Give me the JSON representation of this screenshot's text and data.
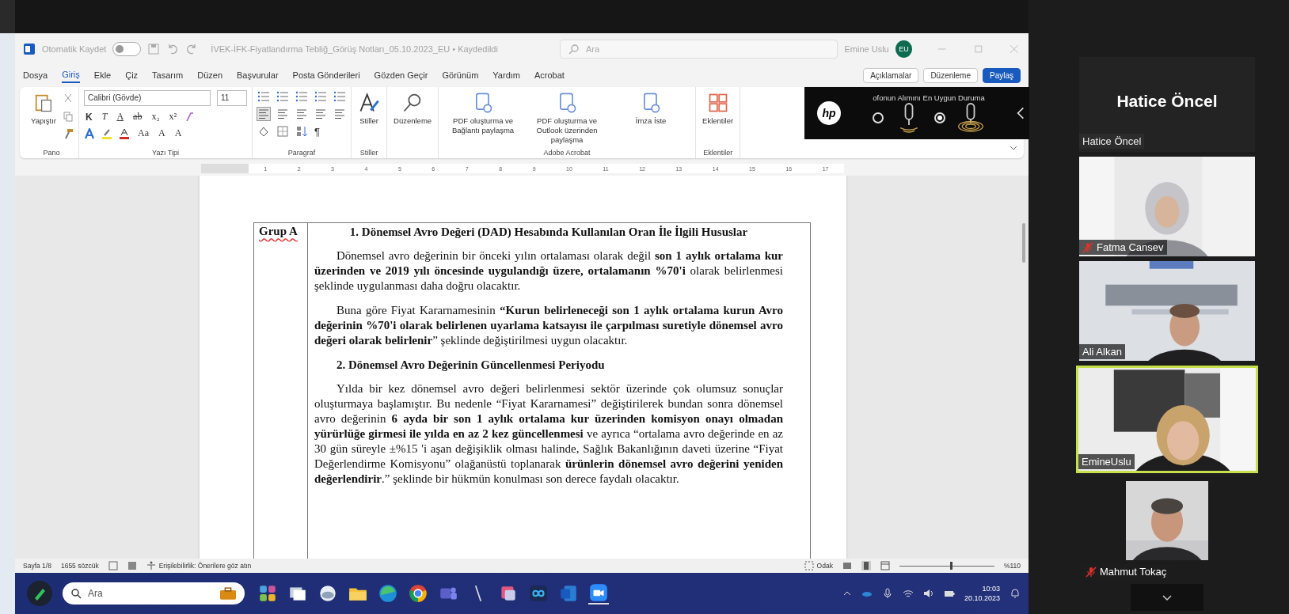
{
  "window": {
    "title": "İVEK-İFK-Fiyatlandırma Tebliğ_Görüş Notları_05.10.2023_EU • Kaydedildi",
    "autosave": {
      "label": "Otomatik Kaydet",
      "on": false
    },
    "search": {
      "placeholder": "Ara"
    },
    "user": {
      "name": "Emine Uslu",
      "initials": "EU"
    }
  },
  "menu_tabs": [
    {
      "label": "Dosya",
      "selected": false
    },
    {
      "label": "Giriş",
      "selected": true
    },
    {
      "label": "Ekle",
      "selected": false
    },
    {
      "label": "Çiz",
      "selected": false
    },
    {
      "label": "Tasarım",
      "selected": false
    },
    {
      "label": "Düzen",
      "selected": false
    },
    {
      "label": "Başvurular",
      "selected": false
    },
    {
      "label": "Posta Gönderileri",
      "selected": false
    },
    {
      "label": "Gözden Geçir",
      "selected": false
    },
    {
      "label": "Görünüm",
      "selected": false
    },
    {
      "label": "Yardım",
      "selected": false
    },
    {
      "label": "Acrobat",
      "selected": false
    }
  ],
  "actions": [
    "Açıklamalar",
    "Düzenleme",
    "Paylaş"
  ],
  "ribbon": {
    "clipboard": {
      "paste": "Yapıştır",
      "group": "Pano"
    },
    "font": {
      "name": "Calibri (Gövde)",
      "size": "11",
      "format_buttons": [
        "K",
        "T",
        "A",
        "ab",
        "x₂",
        "x²"
      ],
      "size_buttons": [
        "Aa",
        "A",
        "A"
      ],
      "group": "Yazı Tipi"
    },
    "paragraph": {
      "mark": "¶",
      "group": "Paragraf"
    },
    "styles": {
      "label": "Stiller",
      "group": "Stiller"
    },
    "editing": {
      "label": "Düzenleme"
    },
    "acrobat": {
      "buttons": [
        "PDF oluşturma ve Bağlantı paylaşma",
        "PDF oluşturma ve Outlook üzerinden paylaşma",
        "İmza İste"
      ],
      "group": "Adobe Acrobat"
    },
    "addins": {
      "label": "Eklentiler",
      "group": "Eklentiler"
    }
  },
  "ruler": [
    "1",
    "2",
    "3",
    "4",
    "5",
    "6",
    "7",
    "8",
    "9",
    "10",
    "11",
    "12",
    "13",
    "14",
    "15",
    "16",
    "17"
  ],
  "document": {
    "group_label": "Grup A",
    "sections": [
      {
        "heading": "1. Dönemsel Avro Değeri (DAD) Hesabında Kullanılan Oran İle İlgili Hususlar",
        "kind": "centered",
        "paragraphs": [
          "Dönemsel avro değerinin bir önceki yılın ortalaması olarak değil **son 1 aylık ortalama kur üzerinden ve 2019 yılı öncesinde uygulandığı üzere, ortalamanın %70'i** olarak belirlenmesi şeklinde uygulanması daha doğru olacaktır.",
          "Buna göre Fiyat Kararnamesinin **“Kurun belirleneceği son 1 aylık ortalama kurun Avro değerinin %70'i olarak belirlenen uyarlama katsayısı ile çarpılması suretiyle dönemsel avro değeri olarak belirlenir**” şeklinde değiştirilmesi uygun olacaktır."
        ]
      },
      {
        "heading": "2. Dönemsel Avro Değerinin Güncellenmesi Periyodu",
        "kind": "indented",
        "paragraphs": [
          "Yılda bir kez dönemsel avro değeri belirlenmesi sektör üzerinde çok olumsuz sonuçlar oluşturmaya başlamıştır. Bu nedenle “Fiyat Kararnamesi” değiştirilerek bundan sonra dönemsel avro değerinin **6 ayda bir son 1 aylık ortalama kur üzerinden komisyon onayı olmadan yürürlüğe girmesi ile yılda en az 2 kez güncellenmesi** ve ayrıca “ortalama avro değerinde en az 30 gün süreyle ±%15 'i aşan değişiklik olması halinde, Sağlık Bakanlığının daveti üzerine “Fiyat Değerlendirme Komisyonu” olağanüstü toplanarak **ürünlerin dönemsel avro değerini yeniden değerlendirir**.” şeklinde bir hükmün konulması son derece faydalı olacaktır."
        ]
      }
    ]
  },
  "status_bar": {
    "page": "Sayfa 1/8",
    "words": "1655 sözcük",
    "accessibility": "Erişilebilirlik: Önerilere göz atın",
    "focus": "Odak",
    "zoom": {
      "level": 0.55,
      "reading": "%110"
    }
  },
  "taskbar": {
    "search": {
      "placeholder": "Ara"
    },
    "time": "10:03",
    "date": "20.10.2023"
  },
  "audio_overlay": {
    "logo": "hp",
    "message": "ofonun Alımını En Uygun Duruma",
    "modes": [
      {
        "selected": false
      },
      {
        "selected": true
      }
    ]
  },
  "meeting": {
    "speaker": "Hatice Öncel",
    "speaker_label": "Hatice Öncel",
    "participants": [
      {
        "name": "Fatma Cansev",
        "muted": true,
        "active": false
      },
      {
        "name": "Ali Alkan",
        "muted": false,
        "active": false
      },
      {
        "name": "EmineUslu",
        "muted": false,
        "active": true
      },
      {
        "name": "Mahmut Tokaç",
        "muted": true,
        "active": false
      }
    ]
  }
}
